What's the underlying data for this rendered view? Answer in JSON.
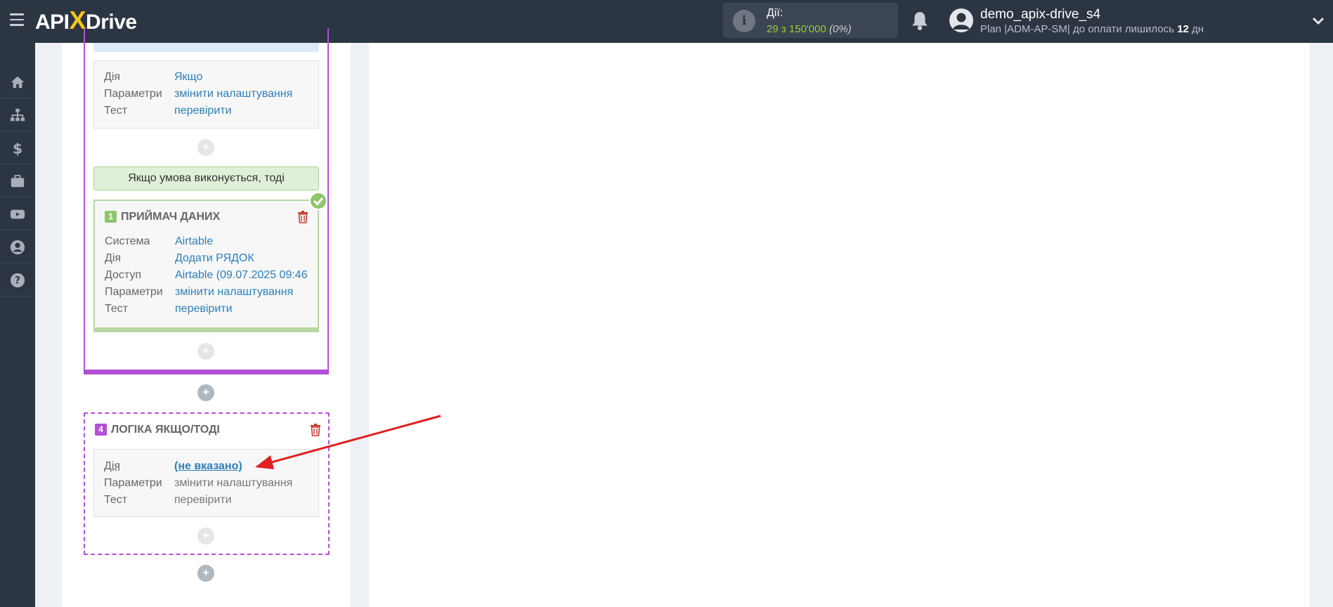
{
  "header": {
    "logo_api": "API",
    "logo_x": "X",
    "logo_drive": "Drive",
    "actions_label": "Дії:",
    "actions_count": "29 з 150'000",
    "actions_pct": "(0%)",
    "user_name": "demo_apix-drive_s4",
    "plan_prefix": "Plan |ADM-AP-SM| до оплати лишилось ",
    "plan_days": "12",
    "plan_suffix": " дн"
  },
  "sidebar": {
    "icons": [
      "home-icon",
      "sitemap-icon",
      "dollar-icon",
      "briefcase-icon",
      "youtube-icon",
      "user-circle-icon",
      "help-icon"
    ]
  },
  "filter_card": {
    "rows": [
      {
        "key": "Дія",
        "value": "Якщо"
      },
      {
        "key": "Параметри",
        "value": "змінити налаштування"
      },
      {
        "key": "Тест",
        "value": "перевірити"
      }
    ]
  },
  "condition_bar": "Якщо умова виконується, тоді",
  "receiver": {
    "number": "1",
    "title": "ПРИЙМАЧ ДАНИХ",
    "rows": [
      {
        "key": "Система",
        "value": "Airtable"
      },
      {
        "key": "Дія",
        "value": "Додати РЯДОК"
      },
      {
        "key": "Доступ",
        "value": "Airtable (09.07.2025 09:46"
      },
      {
        "key": "Параметри",
        "value": "змінити налаштування"
      },
      {
        "key": "Тест",
        "value": "перевірити"
      }
    ]
  },
  "logic": {
    "number": "4",
    "title": "ЛОГІКА ЯКЩО/ТОДІ",
    "rows": [
      {
        "key": "Дія",
        "value": "(не вказано)"
      },
      {
        "key": "Параметри",
        "value": "змінити налаштування"
      },
      {
        "key": "Тест",
        "value": "перевірити"
      }
    ]
  },
  "plus_label": "+",
  "colors": {
    "topbar": "#2c3542",
    "purple": "#b44fd8",
    "green": "#8fc56e",
    "link": "#2e7eb8",
    "trash": "#c0392b",
    "arrow": "#e02020"
  }
}
